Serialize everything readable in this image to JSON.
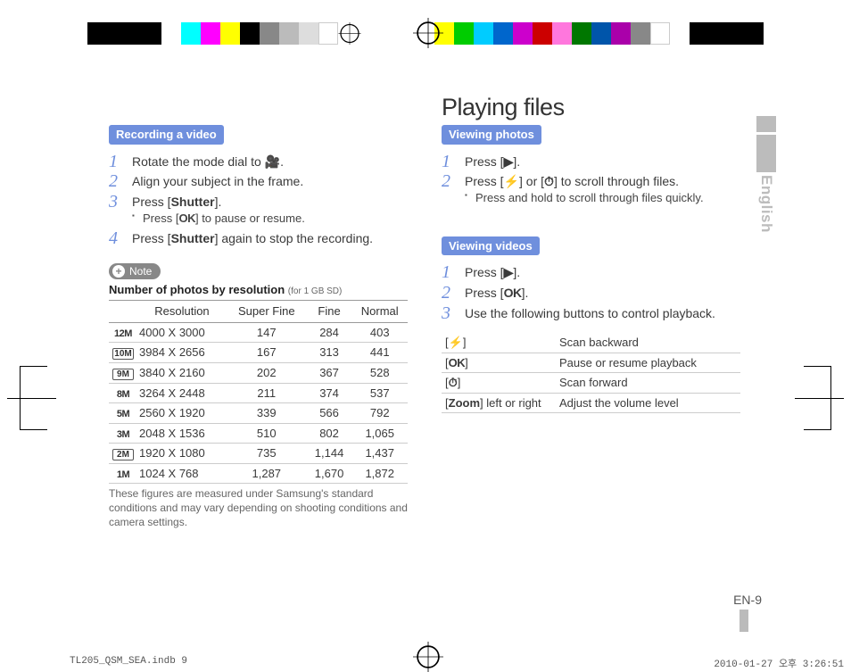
{
  "language_tab": "English",
  "page_number": "EN-9",
  "print_footer": {
    "file": "TL205_QSM_SEA.indb   9",
    "date": "2010-01-27   오후 3:26:51"
  },
  "right_title": "Playing files",
  "left": {
    "heading": "Recording a video",
    "steps": [
      {
        "text_pre": "Rotate the mode dial to ",
        "icon": "video-icon",
        "text_post": "."
      },
      {
        "text": "Align your subject in the frame."
      },
      {
        "text_pre": "Press [",
        "bold": "Shutter",
        "text_post": "].",
        "sub_pre": "Press [",
        "sub_bold": "OK",
        "sub_post": "] to pause or resume."
      },
      {
        "text_pre": "Press [",
        "bold": "Shutter",
        "text_post": "] again to stop the recording."
      }
    ],
    "note_label": "Note",
    "table_title_bold": "Number of photos by resolution",
    "table_title_small": "(for 1 GB SD)",
    "table_headers": [
      "",
      "Resolution",
      "Super Fine",
      "Fine",
      "Normal"
    ],
    "table_rows": [
      {
        "icon": "12M",
        "res": "4000 X 3000",
        "sf": "147",
        "f": "284",
        "n": "403"
      },
      {
        "icon": "10M",
        "res": "3984 X 2656",
        "sf": "167",
        "f": "313",
        "n": "441"
      },
      {
        "icon": "9M",
        "res": "3840 X 2160",
        "sf": "202",
        "f": "367",
        "n": "528"
      },
      {
        "icon": "8M",
        "res": "3264 X 2448",
        "sf": "211",
        "f": "374",
        "n": "537"
      },
      {
        "icon": "5M",
        "res": "2560 X 1920",
        "sf": "339",
        "f": "566",
        "n": "792"
      },
      {
        "icon": "3M",
        "res": "2048 X 1536",
        "sf": "510",
        "f": "802",
        "n": "1,065"
      },
      {
        "icon": "2M",
        "res": "1920 X 1080",
        "sf": "735",
        "f": "1,144",
        "n": "1,437"
      },
      {
        "icon": "1M",
        "res": "1024 X 768",
        "sf": "1,287",
        "f": "1,670",
        "n": "1,872"
      }
    ],
    "table_footnote": "These figures are measured under Samsung's standard conditions and may vary depending on shooting conditions and camera settings."
  },
  "right": {
    "photos_heading": "Viewing photos",
    "photos_steps": [
      {
        "text_pre": "Press [",
        "icon": "play-icon",
        "text_post": "]."
      },
      {
        "text_pre": "Press [",
        "icon": "flash-icon",
        "text_mid": "] or [",
        "icon2": "timer-icon",
        "text_post": "] to scroll through files.",
        "sub": "Press and hold to scroll through files quickly."
      }
    ],
    "videos_heading": "Viewing videos",
    "videos_steps": [
      {
        "text_pre": "Press [",
        "icon": "play-icon",
        "text_post": "]."
      },
      {
        "text_pre": "Press [",
        "bold": "OK",
        "text_post": "]."
      },
      {
        "text": "Use the following buttons to control playback."
      }
    ],
    "controls": [
      {
        "btn_icon": "flash-icon",
        "btn_pre": "[",
        "btn_post": "]",
        "desc": "Scan backward"
      },
      {
        "btn_bold": "OK",
        "btn_pre": "[",
        "btn_post": "]",
        "desc": "Pause or resume playback"
      },
      {
        "btn_icon": "timer-icon",
        "btn_pre": "[",
        "btn_post": "]",
        "desc": "Scan forward"
      },
      {
        "btn_pre": "[",
        "btn_bold": "Zoom",
        "btn_post": "] left or right",
        "desc": "Adjust the volume level"
      }
    ]
  }
}
